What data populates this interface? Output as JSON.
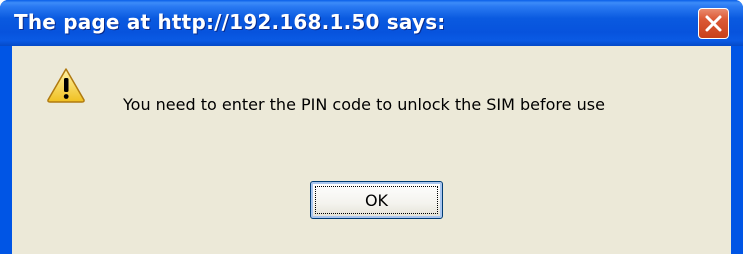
{
  "dialog": {
    "title": "The page at http://192.168.1.50 says:",
    "message": "You need to enter the PIN code to unlock the SIM before use",
    "ok_label": "OK",
    "icon": "warning-icon",
    "close_icon": "close-icon"
  },
  "colors": {
    "titlebar": "#0a5ae0",
    "body": "#ece9d8",
    "close_button": "#dc5a36",
    "warning_fill": "#f8d64e"
  }
}
